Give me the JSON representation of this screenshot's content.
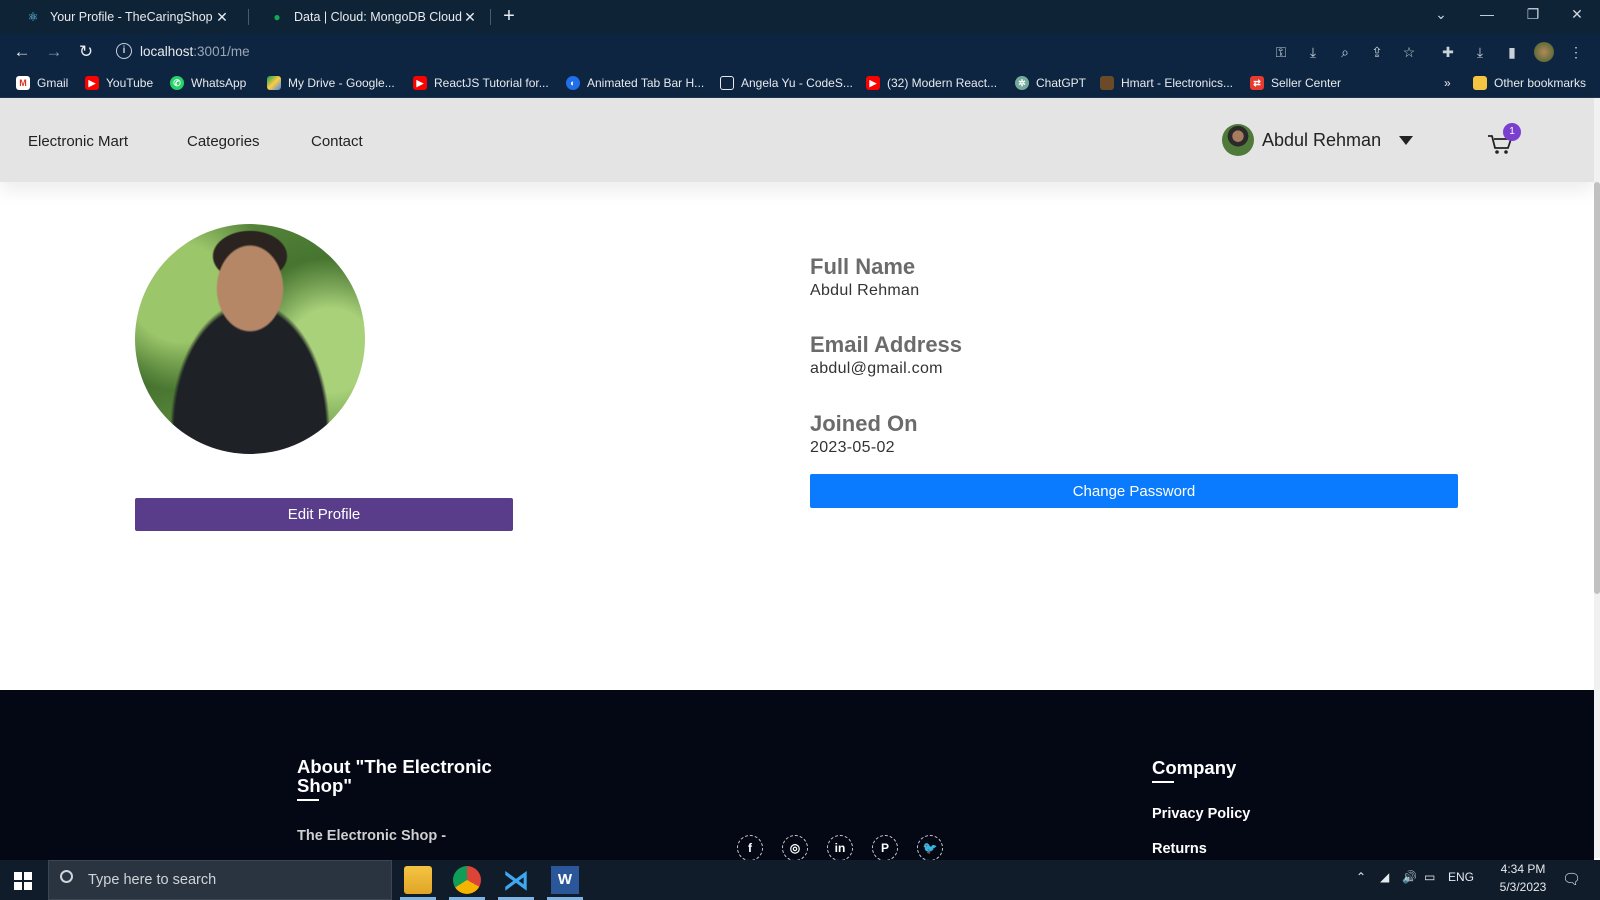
{
  "browser": {
    "tabs": [
      {
        "title": "Your Profile - TheCaringShop",
        "active": true
      },
      {
        "title": "Data | Cloud: MongoDB Cloud",
        "active": false
      }
    ],
    "url_host": "localhost",
    "url_path": ":3001/me",
    "bookmarks": [
      "Gmail",
      "YouTube",
      "WhatsApp",
      "My Drive - Google...",
      "ReactJS Tutorial for...",
      "Animated Tab Bar H...",
      "Angela Yu - CodeS...",
      "(32) Modern React...",
      "ChatGPT",
      "Hmart - Electronics...",
      "Seller Center"
    ],
    "overflow_label": "»",
    "other_bookmarks": "Other bookmarks"
  },
  "navbar": {
    "links": [
      "Electronic Mart",
      "Categories",
      "Contact"
    ],
    "user_name": "Abdul Rehman",
    "cart_count": "1"
  },
  "profile": {
    "edit_button": "Edit Profile",
    "fields": [
      {
        "label": "Full Name",
        "value": "Abdul Rehman"
      },
      {
        "label": "Email Address",
        "value": "abdul@gmail.com"
      },
      {
        "label": "Joined On",
        "value": "2023-05-02"
      }
    ],
    "change_password_button": "Change Password"
  },
  "footer": {
    "about_title": "About \"The Electronic Shop\"",
    "about_text": "The Electronic Shop -",
    "social": [
      "facebook",
      "instagram",
      "linkedin",
      "pinterest",
      "twitter"
    ],
    "company_title": "Company",
    "company_links": [
      "Privacy Policy",
      "Returns"
    ]
  },
  "taskbar": {
    "search_placeholder": "Type here to search",
    "language": "ENG",
    "time": "4:34 PM",
    "date": "5/3/2023"
  },
  "colors": {
    "edit_button": "#5a3d8a",
    "change_password_button": "#0a7bff",
    "cart_badge": "#7a3fcf",
    "footer_bg": "#040714"
  }
}
